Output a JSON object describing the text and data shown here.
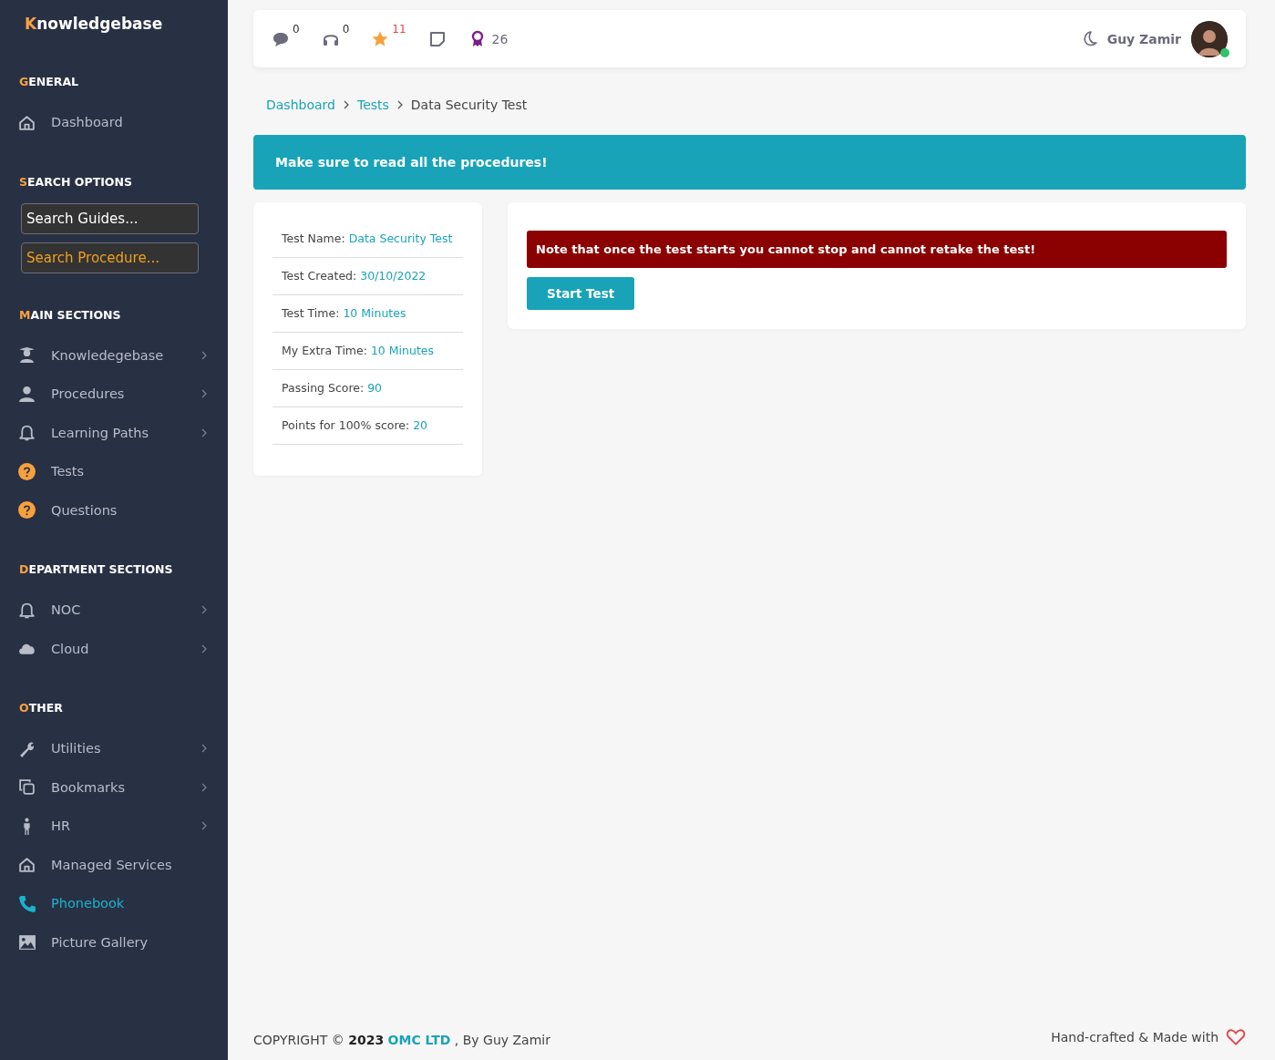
{
  "sidebar": {
    "brand": "Knowledgebase",
    "sections": [
      {
        "title": "GENERAL",
        "items": [
          {
            "kind": "home",
            "label": "Dashboard",
            "submenu": false,
            "selected": false
          }
        ]
      },
      {
        "title": "SEARCH OPTIONS",
        "fields": [
          {
            "placeholder": "Search Guides...",
            "accent": false
          },
          {
            "placeholder": "Search Procedure...",
            "accent": true
          }
        ]
      },
      {
        "title": "MAIN SECTIONS",
        "items": [
          {
            "kind": "graduate",
            "label": "Knowledegebase",
            "submenu": true,
            "selected": false
          },
          {
            "kind": "person",
            "label": "Procedures",
            "submenu": true,
            "selected": false
          },
          {
            "kind": "bell",
            "label": "Learning Paths",
            "submenu": true,
            "selected": false
          },
          {
            "kind": "question",
            "label": "Tests",
            "submenu": false,
            "selected": false
          },
          {
            "kind": "question",
            "label": "Questions",
            "submenu": false,
            "selected": false
          }
        ]
      },
      {
        "title": "DEPARTMENT SECTIONS",
        "items": [
          {
            "kind": "bell",
            "label": "NOC",
            "submenu": true,
            "selected": false
          },
          {
            "kind": "cloud",
            "label": "Cloud",
            "submenu": true,
            "selected": false
          }
        ]
      },
      {
        "title": "OTHER",
        "items": [
          {
            "kind": "wrench",
            "label": "Utilities",
            "submenu": true,
            "selected": false
          },
          {
            "kind": "copy",
            "label": "Bookmarks",
            "submenu": true,
            "selected": false
          },
          {
            "kind": "figure",
            "label": "HR",
            "submenu": true,
            "selected": false
          },
          {
            "kind": "home",
            "label": "Managed Services",
            "submenu": false,
            "selected": false
          },
          {
            "kind": "phone",
            "label": "Phonebook",
            "submenu": false,
            "selected": true
          },
          {
            "kind": "image",
            "label": "Picture Gallery",
            "submenu": false,
            "selected": false
          }
        ]
      }
    ]
  },
  "header": {
    "counters": [
      {
        "count": "0",
        "kind": "superscript",
        "alert": false
      },
      {
        "count": "0",
        "kind": "superscript",
        "alert": false
      },
      {
        "count": "11",
        "kind": "superscript",
        "alert": true
      },
      {
        "kind": "plain"
      },
      {
        "count": "26",
        "kind": "inline",
        "alert": false
      }
    ],
    "user": {
      "name": "Guy Zamir",
      "online": true
    }
  },
  "breadcrumb": [
    {
      "label": "Dashboard",
      "link": true
    },
    {
      "label": "Tests",
      "link": true
    },
    {
      "label": "Data Security Test",
      "link": false
    }
  ],
  "banner": "Make sure to read all the procedures!",
  "details": [
    {
      "label": "Test Name:",
      "value": "Data Security Test"
    },
    {
      "label": "Test Created:",
      "value": "30/10/2022"
    },
    {
      "label": "Test Time:",
      "value": "10 Minutes"
    },
    {
      "label": "My Extra Time:",
      "value": "10 Minutes"
    },
    {
      "label": "Passing Score:",
      "value": "90"
    },
    {
      "label": "Points for 100% score:",
      "value": "20"
    }
  ],
  "warning": "Note that once the test starts you cannot stop and cannot retake the test!",
  "start_button": "Start Test",
  "footer": {
    "copyright": "COPYRIGHT © **2023**",
    "company": "OMC LTD",
    "author": ", By Guy Zamir",
    "credit": "Hand-crafted & Made with"
  }
}
